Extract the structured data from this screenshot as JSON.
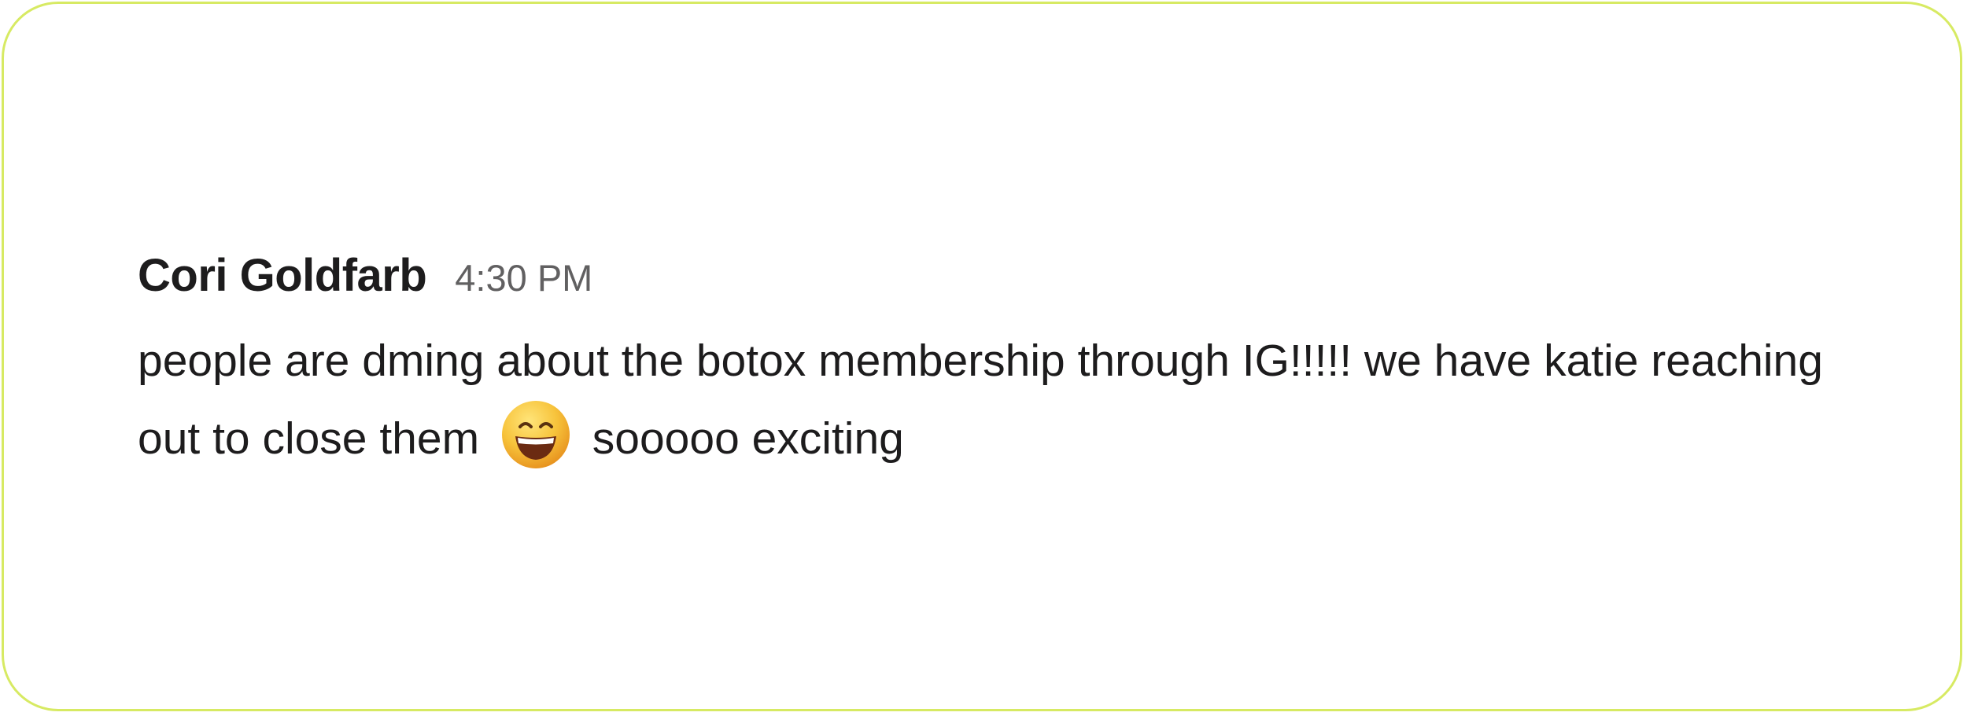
{
  "message": {
    "author": "Cori Goldfarb",
    "timestamp": "4:30 PM",
    "text_before_emoji": "people are dming about the botox membership through IG!!!!! we have katie reaching out to close them",
    "emoji": "grinning-face-with-smiling-eyes",
    "text_after_emoji": "sooooo exciting"
  },
  "colors": {
    "border": "#d7ea63",
    "text": "#1d1c1d",
    "timestamp": "#616061",
    "emoji_face": "#f7b42c"
  }
}
